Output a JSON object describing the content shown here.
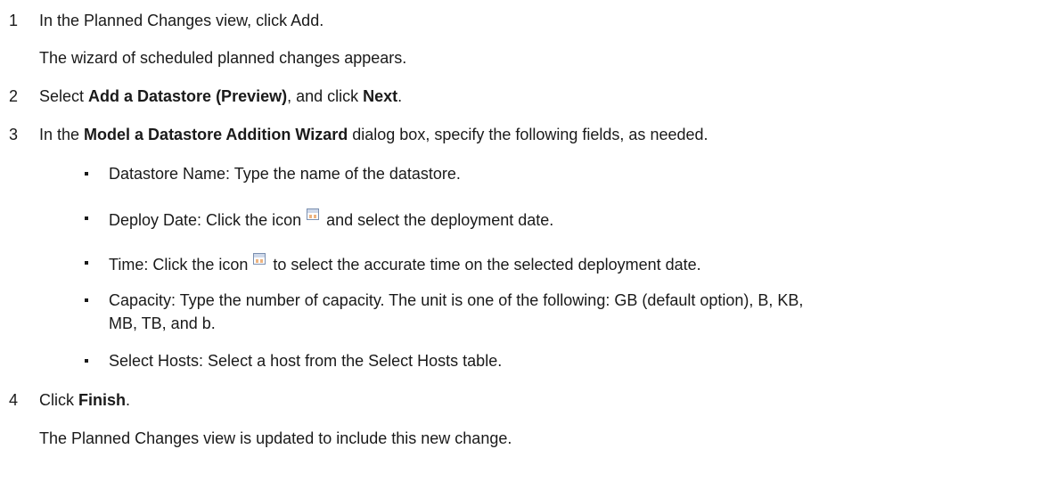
{
  "steps": [
    {
      "number": "1",
      "text": "In the Planned Changes view, click Add.",
      "note": "The wizard of scheduled planned changes appears."
    },
    {
      "number": "2",
      "pre": "Select ",
      "bold1": "Add a Datastore (Preview)",
      "mid": ", and click ",
      "bold2": "Next",
      "post": "."
    },
    {
      "number": "3",
      "pre": "In the ",
      "bold1": "Model a Datastore Addition Wizard",
      "post": " dialog box, specify the following fields, as needed.",
      "fields": {
        "datastore_name": "Datastore Name: Type the name of the datastore.",
        "deploy_date_pre": "Deploy Date: Click the icon",
        "deploy_date_post": "and select the deployment date.",
        "time_pre": "Time: Click the icon",
        "time_post": "to select the accurate time on the selected deployment date.",
        "capacity_line1": "Capacity: Type the number of capacity. The unit is one of the following: GB (default option), B, KB,",
        "capacity_line2": "MB, TB, and b.",
        "select_hosts": "Select Hosts: Select a host from the Select Hosts table."
      }
    },
    {
      "number": "4",
      "pre": "Click ",
      "bold1": "Finish",
      "post": ".",
      "note": "The Planned Changes view is updated to include this new change."
    }
  ],
  "icons": {
    "calendar": "calendar-icon"
  }
}
